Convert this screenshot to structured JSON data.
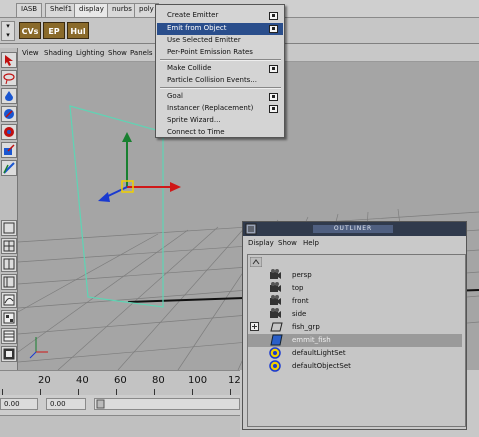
{
  "shelf": {
    "tabs": [
      "IASB",
      "Shelf1",
      "display",
      "nurbs",
      "poly"
    ],
    "active_tab": "display",
    "buttons": [
      "CVs",
      "EP",
      "Hul"
    ]
  },
  "panel_menu": [
    "View",
    "Shading",
    "Lighting",
    "Show",
    "Panels"
  ],
  "emit_menu": {
    "items": [
      {
        "label": "Create Emitter",
        "option_box": true
      },
      {
        "label": "Emit from Object",
        "option_box": true,
        "highlighted": true
      },
      {
        "label": "Use Selected Emitter",
        "option_box": false
      },
      {
        "label": "Per-Point Emission Rates",
        "option_box": false
      },
      {
        "label": "Make Collide",
        "option_box": true
      },
      {
        "label": "Particle Collision Events...",
        "option_box": false
      },
      {
        "label": "Goal",
        "option_box": true
      },
      {
        "label": "Instancer (Replacement)",
        "option_box": true
      },
      {
        "label": "Sprite Wizard...",
        "option_box": false
      },
      {
        "label": "Connect to Time",
        "option_box": false
      }
    ]
  },
  "outliner": {
    "title": "OUTLINER",
    "menu": [
      "Display",
      "Show",
      "Help"
    ],
    "items": [
      {
        "label": "persp",
        "icon": "camera-icon"
      },
      {
        "label": "top",
        "icon": "camera-icon"
      },
      {
        "label": "front",
        "icon": "camera-icon"
      },
      {
        "label": "side",
        "icon": "camera-icon"
      },
      {
        "label": "fish_grp",
        "icon": "group-icon",
        "expandable": true
      },
      {
        "label": "emmit_fish",
        "icon": "emitter-icon",
        "selected": true
      },
      {
        "label": "defaultLightSet",
        "icon": "set-icon"
      },
      {
        "label": "defaultObjectSet",
        "icon": "set-icon"
      }
    ]
  },
  "time_slider": {
    "ticks": [
      "20",
      "40",
      "60",
      "80",
      "100",
      "12"
    ]
  },
  "range": {
    "start": "0.00",
    "current": "0.00"
  },
  "colors": {
    "viewport_bg": "#a5a5a5",
    "grid": "#7d7d7d",
    "plane_outline": "#5fd4b4",
    "axis_x": "#d01818",
    "axis_y": "#188030",
    "axis_z": "#1a3ad0",
    "highlight": "#2a4e8c",
    "pivot": "#f0d000"
  }
}
